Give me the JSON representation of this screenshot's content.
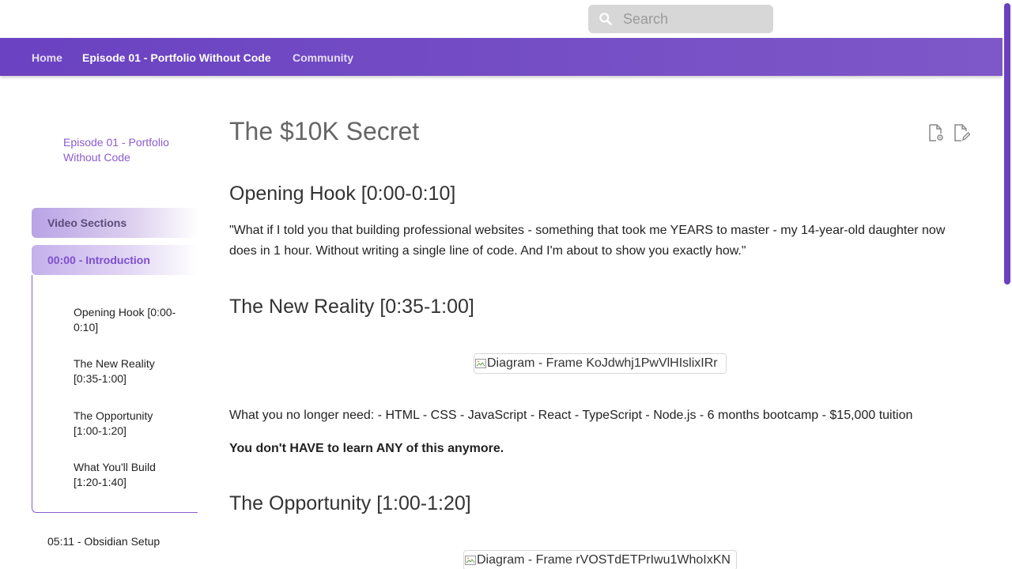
{
  "header": {
    "search": {
      "placeholder": "Search",
      "value": ""
    }
  },
  "nav": {
    "items": [
      {
        "label": "Home",
        "active": false
      },
      {
        "label": "Episode 01 - Portfolio Without Code",
        "active": true
      },
      {
        "label": "Community",
        "active": false
      }
    ]
  },
  "sidebar": {
    "episode_title": "Episode 01 - Portfolio Without Code",
    "sections": [
      {
        "label": "Video Sections"
      },
      {
        "label": "00:00 - Introduction"
      }
    ],
    "subitems": [
      {
        "label": "Opening Hook [0:00-0:10]"
      },
      {
        "label": "The New Reality [0:35-1:00]"
      },
      {
        "label": "The Opportunity [1:00-1:20]"
      },
      {
        "label": "What You'll Build [1:20-1:40]"
      }
    ],
    "next_section": "05:11 - Obsidian Setup"
  },
  "main": {
    "title": "The $10K Secret",
    "headings": [
      "Opening Hook [0:00-0:10]",
      "The New Reality [0:35-1:00]",
      "The Opportunity [1:00-1:20]"
    ],
    "quote": "\"What if I told you that building professional websites - something that took me YEARS to master - my 14-year-old daughter now does in 1 hour. Without writing a single line of code. And I'm about to show you exactly how.\"",
    "diagram1_alt": "Diagram - Frame KoJdwhj1PwVlHIslixIRr",
    "needs_text": "What you no longer need: - HTML - CSS - JavaScript - React - TypeScript - Node.js - 6 months bootcamp - $15,000 tuition",
    "bold_text": "You don't HAVE to learn ANY of this anymore.",
    "diagram2_alt": "Diagram - Frame rVOSTdETPrIwu1WhoIxKN"
  },
  "icons": {
    "search": "search-icon",
    "view_source": "view-source-icon",
    "edit_page": "edit-page-icon",
    "broken_image": "broken-image-icon"
  },
  "colors": {
    "accent": "#7b4fcf",
    "nav_bg": "#6a42c2",
    "sidebar_active_text": "#7d4fcf"
  }
}
